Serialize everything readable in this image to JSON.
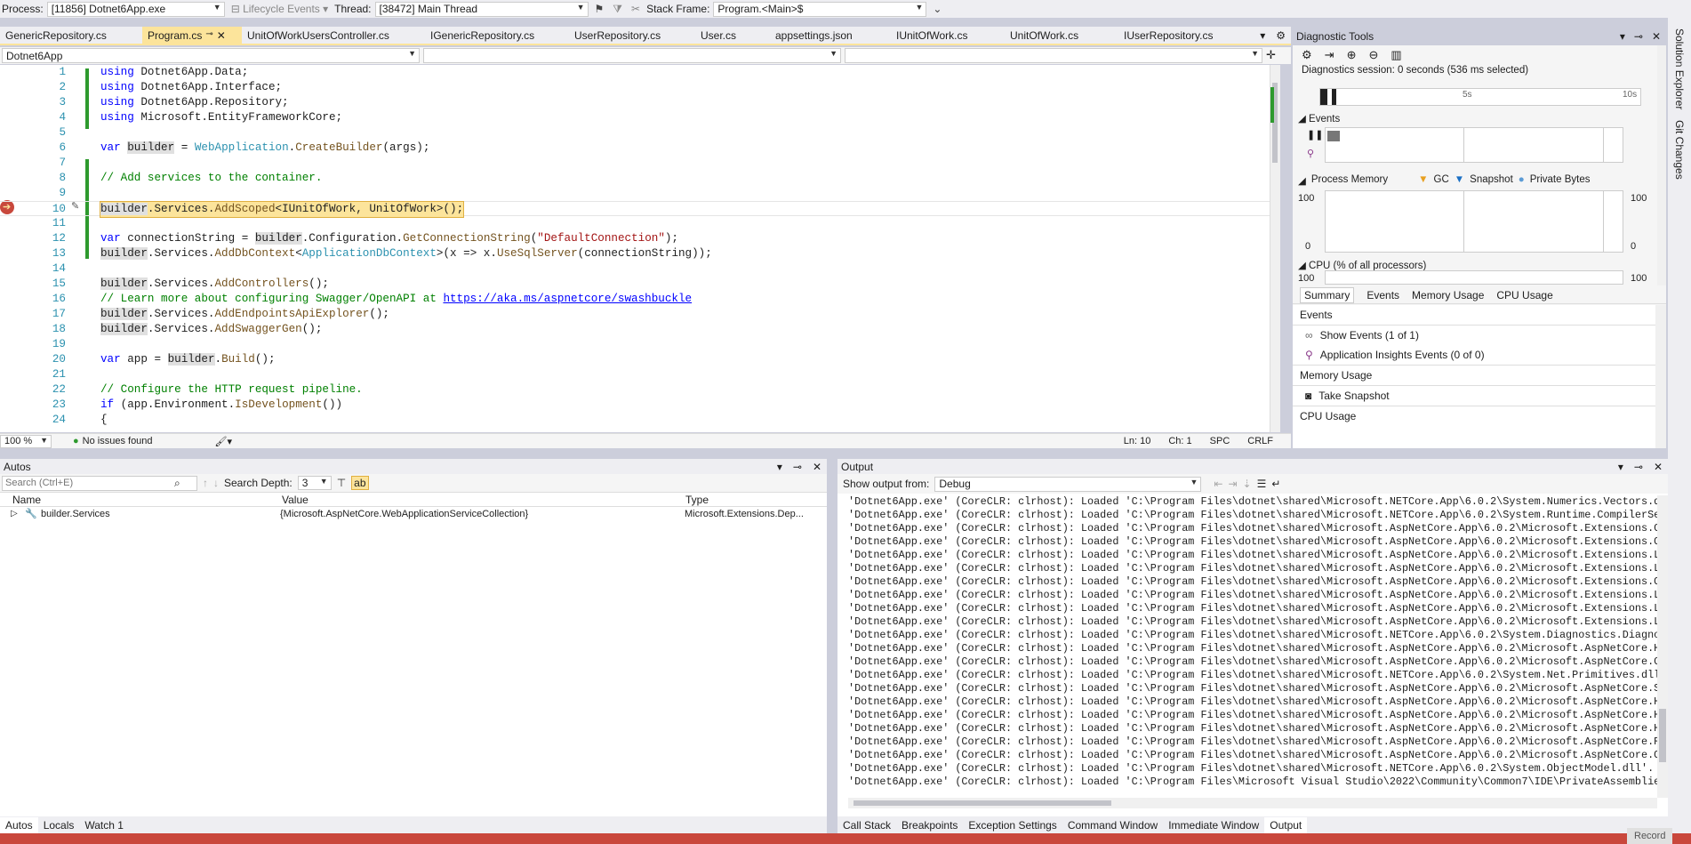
{
  "debug_toolbar": {
    "process_label": "Process:",
    "process_value": "[11856] Dotnet6App.exe",
    "lifecycle_label": "Lifecycle Events",
    "thread_label": "Thread:",
    "thread_value": "[38472] Main Thread",
    "stackframe_label": "Stack Frame:",
    "stackframe_value": "Program.<Main>$"
  },
  "tabs": [
    {
      "label": "GenericRepository.cs"
    },
    {
      "label": "Program.cs"
    },
    {
      "label": "UnitOfWorkUsersController.cs"
    },
    {
      "label": "IGenericRepository.cs"
    },
    {
      "label": "UserRepository.cs"
    },
    {
      "label": "User.cs"
    },
    {
      "label": "appsettings.json"
    },
    {
      "label": "IUnitOfWork.cs"
    },
    {
      "label": "UnitOfWork.cs"
    },
    {
      "label": "IUserRepository.cs"
    }
  ],
  "editor": {
    "project": "Dotnet6App",
    "line_numbers": [
      "1",
      "2",
      "3",
      "4",
      "5",
      "6",
      "7",
      "8",
      "9",
      "10",
      "11",
      "12",
      "13",
      "14",
      "15",
      "16",
      "17",
      "18",
      "19",
      "20",
      "21",
      "22",
      "23",
      "24"
    ],
    "code": {
      "l1_kw": "using",
      "l1_rest": " Dotnet6App.Data;",
      "l2_kw": "using",
      "l2_rest": " Dotnet6App.Interface;",
      "l3_kw": "using",
      "l3_rest": " Dotnet6App.Repository;",
      "l4_kw": "using",
      "l4_rest": " Microsoft.EntityFrameworkCore;",
      "l6_a": "var",
      "l6_b": "builder",
      "l6_c": " = ",
      "l6_d": "WebApplication",
      "l6_e": ".",
      "l6_f": "CreateBuilder",
      "l6_g": "(args);",
      "l8": "// Add services to the container.",
      "l10_a": "builder",
      "l10_b": ".Services.",
      "l10_c": "AddScoped",
      "l10_d": "<IUnitOfWork, UnitOfWork>();",
      "l12_a": "var",
      "l12_b": " connectionString = ",
      "l12_c": "builder",
      "l12_d": ".Configuration.",
      "l12_e": "GetConnectionString",
      "l12_f": "(",
      "l12_g": "\"DefaultConnection\"",
      "l12_h": ");",
      "l13_a": "builder",
      "l13_b": ".Services.",
      "l13_c": "AddDbContext",
      "l13_d": "<",
      "l13_e": "ApplicationDbContext",
      "l13_f": ">(x => x.",
      "l13_g": "UseSqlServer",
      "l13_h": "(connectionString));",
      "l15_a": "builder",
      "l15_b": ".Services.",
      "l15_c": "AddControllers",
      "l15_d": "();",
      "l16_a": "// Learn more about configuring Swagger/OpenAPI at ",
      "l16_b": "https://aka.ms/aspnetcore/swashbuckle",
      "l17_a": "builder",
      "l17_b": ".Services.",
      "l17_c": "AddEndpointsApiExplorer",
      "l17_d": "();",
      "l18_a": "builder",
      "l18_b": ".Services.",
      "l18_c": "AddSwaggerGen",
      "l18_d": "();",
      "l20_a": "var",
      "l20_b": " app = ",
      "l20_c": "builder",
      "l20_d": ".",
      "l20_e": "Build",
      "l20_f": "();",
      "l22": "// Configure the HTTP request pipeline.",
      "l23_a": "if",
      "l23_b": " (app.Environment.",
      "l23_c": "IsDevelopment",
      "l23_d": "())",
      "l24": "{"
    }
  },
  "editor_status": {
    "zoom": "100 %",
    "issues": "No issues found",
    "ln": "Ln: 10",
    "ch": "Ch: 1",
    "spc": "SPC",
    "crlf": "CRLF"
  },
  "diagnostics": {
    "title": "Diagnostic Tools",
    "session": "Diagnostics session: 0 seconds (536 ms selected)",
    "tick_5s": "5s",
    "tick_10s": "10s",
    "events_label": "Events",
    "process_memory_label": "Process Memory",
    "legend_gc": "GC",
    "legend_snapshot": "Snapshot",
    "legend_private": "Private Bytes",
    "mem_max_left": "100",
    "mem_min_left": "0",
    "mem_max_right": "100",
    "mem_min_right": "0",
    "cpu_label": "CPU (% of all processors)",
    "cpu_max_left": "100",
    "cpu_max_right": "100",
    "subtabs": [
      "Summary",
      "Events",
      "Memory Usage",
      "CPU Usage"
    ],
    "summary": {
      "events_header": "Events",
      "show_events": "Show Events (1 of 1)",
      "app_insights": "Application Insights Events (0 of 0)",
      "memory_header": "Memory Usage",
      "take_snapshot": "Take Snapshot",
      "cpu_header": "CPU Usage"
    }
  },
  "side_strip": {
    "solution_explorer": "Solution Explorer",
    "git_changes": "Git Changes"
  },
  "autos": {
    "title": "Autos",
    "search_placeholder": "Search (Ctrl+E)",
    "depth_label": "Search Depth:",
    "depth_value": "3",
    "columns": [
      "Name",
      "Value",
      "Type"
    ],
    "row": {
      "name": "builder.Services",
      "value": "{Microsoft.AspNetCore.WebApplicationServiceCollection}",
      "type": "Microsoft.Extensions.Dep..."
    },
    "tabs": [
      "Autos",
      "Locals",
      "Watch 1"
    ]
  },
  "output": {
    "title": "Output",
    "show_from_label": "Show output from:",
    "show_from_value": "Debug",
    "lines": [
      "'Dotnet6App.exe' (CoreCLR: clrhost): Loaded 'C:\\Program Files\\dotnet\\shared\\Microsoft.NETCore.App\\6.0.2\\System.Numerics.Vectors.dl",
      "'Dotnet6App.exe' (CoreCLR: clrhost): Loaded 'C:\\Program Files\\dotnet\\shared\\Microsoft.NETCore.App\\6.0.2\\System.Runtime.CompilerSer",
      "'Dotnet6App.exe' (CoreCLR: clrhost): Loaded 'C:\\Program Files\\dotnet\\shared\\Microsoft.AspNetCore.App\\6.0.2\\Microsoft.Extensions.Co",
      "'Dotnet6App.exe' (CoreCLR: clrhost): Loaded 'C:\\Program Files\\dotnet\\shared\\Microsoft.AspNetCore.App\\6.0.2\\Microsoft.Extensions.Op",
      "'Dotnet6App.exe' (CoreCLR: clrhost): Loaded 'C:\\Program Files\\dotnet\\shared\\Microsoft.AspNetCore.App\\6.0.2\\Microsoft.Extensions.Lo",
      "'Dotnet6App.exe' (CoreCLR: clrhost): Loaded 'C:\\Program Files\\dotnet\\shared\\Microsoft.AspNetCore.App\\6.0.2\\Microsoft.Extensions.Lo",
      "'Dotnet6App.exe' (CoreCLR: clrhost): Loaded 'C:\\Program Files\\dotnet\\shared\\Microsoft.AspNetCore.App\\6.0.2\\Microsoft.Extensions.Op",
      "'Dotnet6App.exe' (CoreCLR: clrhost): Loaded 'C:\\Program Files\\dotnet\\shared\\Microsoft.AspNetCore.App\\6.0.2\\Microsoft.Extensions.Lo",
      "'Dotnet6App.exe' (CoreCLR: clrhost): Loaded 'C:\\Program Files\\dotnet\\shared\\Microsoft.AspNetCore.App\\6.0.2\\Microsoft.Extensions.Lo",
      "'Dotnet6App.exe' (CoreCLR: clrhost): Loaded 'C:\\Program Files\\dotnet\\shared\\Microsoft.AspNetCore.App\\6.0.2\\Microsoft.Extensions.Lo",
      "'Dotnet6App.exe' (CoreCLR: clrhost): Loaded 'C:\\Program Files\\dotnet\\shared\\Microsoft.NETCore.App\\6.0.2\\System.Diagnostics.Diagnos",
      "'Dotnet6App.exe' (CoreCLR: clrhost): Loaded 'C:\\Program Files\\dotnet\\shared\\Microsoft.AspNetCore.App\\6.0.2\\Microsoft.AspNetCore.Ht",
      "'Dotnet6App.exe' (CoreCLR: clrhost): Loaded 'C:\\Program Files\\dotnet\\shared\\Microsoft.AspNetCore.App\\6.0.2\\Microsoft.AspNetCore.Co",
      "'Dotnet6App.exe' (CoreCLR: clrhost): Loaded 'C:\\Program Files\\dotnet\\shared\\Microsoft.NETCore.App\\6.0.2\\System.Net.Primitives.dll'",
      "'Dotnet6App.exe' (CoreCLR: clrhost): Loaded 'C:\\Program Files\\dotnet\\shared\\Microsoft.AspNetCore.App\\6.0.2\\Microsoft.AspNetCore.Se",
      "'Dotnet6App.exe' (CoreCLR: clrhost): Loaded 'C:\\Program Files\\dotnet\\shared\\Microsoft.AspNetCore.App\\6.0.2\\Microsoft.AspNetCore.Ho",
      "'Dotnet6App.exe' (CoreCLR: clrhost): Loaded 'C:\\Program Files\\dotnet\\shared\\Microsoft.AspNetCore.App\\6.0.2\\Microsoft.AspNetCore.Ho",
      "'Dotnet6App.exe' (CoreCLR: clrhost): Loaded 'C:\\Program Files\\dotnet\\shared\\Microsoft.AspNetCore.App\\6.0.2\\Microsoft.AspNetCore.Ht",
      "'Dotnet6App.exe' (CoreCLR: clrhost): Loaded 'C:\\Program Files\\dotnet\\shared\\Microsoft.AspNetCore.App\\6.0.2\\Microsoft.AspNetCore.Ro",
      "'Dotnet6App.exe' (CoreCLR: clrhost): Loaded 'C:\\Program Files\\dotnet\\shared\\Microsoft.AspNetCore.App\\6.0.2\\Microsoft.AspNetCore.Ob",
      "'Dotnet6App.exe' (CoreCLR: clrhost): Loaded 'C:\\Program Files\\dotnet\\shared\\Microsoft.NETCore.App\\6.0.2\\System.ObjectModel.dll'. S",
      "'Dotnet6App.exe' (CoreCLR: clrhost): Loaded 'C:\\Program Files\\Microsoft Visual Studio\\2022\\Community\\Common7\\IDE\\PrivateAssemblies"
    ],
    "tabs": [
      "Call Stack",
      "Breakpoints",
      "Exception Settings",
      "Command Window",
      "Immediate Window",
      "Output"
    ]
  },
  "status": {
    "record": "Record"
  }
}
